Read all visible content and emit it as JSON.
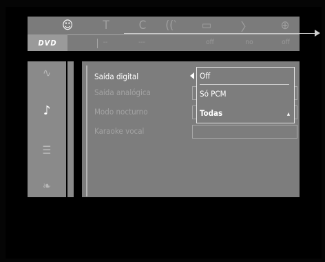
{
  "top_bar": {
    "logo": "DVD",
    "icons": [
      {
        "name": "subtitle-audio-icon",
        "glyph": "☺",
        "active": true
      },
      {
        "name": "title-icon",
        "glyph": "T",
        "active": false
      },
      {
        "name": "chapter-icon",
        "glyph": "C",
        "active": false
      },
      {
        "name": "audio-sound-icon",
        "glyph": "((‵",
        "active": false
      },
      {
        "name": "subtitle-bubble-icon",
        "glyph": "▭",
        "active": false
      },
      {
        "name": "angle-icon",
        "glyph": "〉",
        "active": false
      },
      {
        "name": "zoom-icon",
        "glyph": "⊕",
        "active": false
      }
    ],
    "values": [
      "--",
      "---",
      "off",
      "no",
      "off"
    ]
  },
  "sidebar": {
    "icons": [
      {
        "name": "picture-settings-icon",
        "glyph": "∿"
      },
      {
        "name": "audio-settings-icon",
        "glyph": "♪"
      },
      {
        "name": "language-settings-icon",
        "glyph": "☰"
      },
      {
        "name": "feature-settings-icon",
        "glyph": "❧"
      }
    ]
  },
  "menu": {
    "rows": [
      {
        "label": "Saída digital",
        "active": true
      },
      {
        "label": "Saída analógica",
        "active": false
      },
      {
        "label": "Modo nocturno",
        "active": false
      },
      {
        "label": "Karaoke vocal",
        "active": false
      }
    ]
  },
  "dropdown": {
    "options": [
      "Off",
      "Só PCM",
      "Todas"
    ],
    "selected": "Todas"
  }
}
